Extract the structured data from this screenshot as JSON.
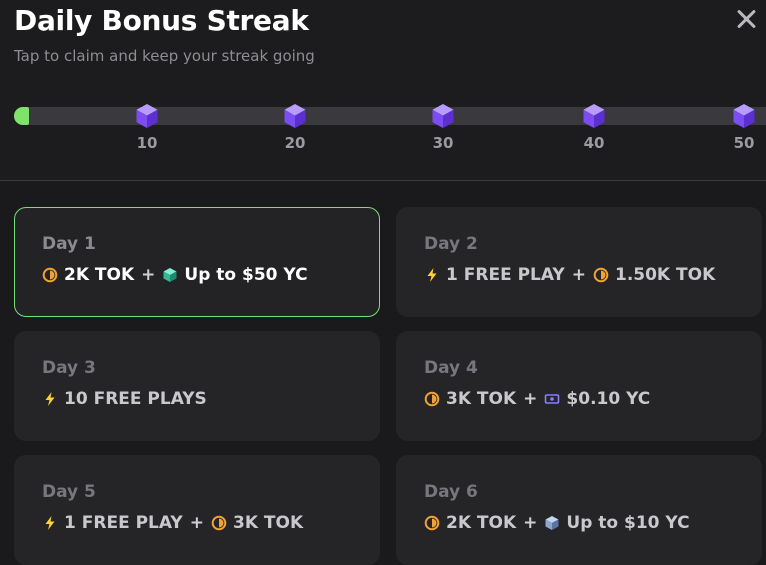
{
  "title": "Daily Bonus Streak",
  "subtitle": "Tap to claim and keep your streak going",
  "progress": {
    "current": 1,
    "max": 50,
    "fill_color": "#7fe36b"
  },
  "milestones": [
    {
      "label": "10",
      "icon": "purple-cube-icon"
    },
    {
      "label": "20",
      "icon": "purple-cube-icon"
    },
    {
      "label": "30",
      "icon": "purple-cube-icon"
    },
    {
      "label": "40",
      "icon": "purple-cube-icon"
    },
    {
      "label": "50",
      "icon": "purple-cube-icon"
    }
  ],
  "days": [
    {
      "label": "Day 1",
      "active": true,
      "rewards": [
        {
          "icon": "tok-coin-icon",
          "text": "2K TOK"
        },
        {
          "icon": "teal-cube-icon",
          "text": "Up to $50 YC"
        }
      ]
    },
    {
      "label": "Day 2",
      "rewards": [
        {
          "icon": "lightning-icon",
          "text": "1 FREE PLAY"
        },
        {
          "icon": "tok-coin-icon",
          "text": "1.50K TOK"
        }
      ]
    },
    {
      "label": "Day 3",
      "rewards": [
        {
          "icon": "lightning-icon",
          "text": "10 FREE PLAYS"
        }
      ]
    },
    {
      "label": "Day 4",
      "rewards": [
        {
          "icon": "tok-coin-icon",
          "text": "3K TOK"
        },
        {
          "icon": "cash-icon",
          "text": "$0.10 YC"
        }
      ]
    },
    {
      "label": "Day 5",
      "rewards": [
        {
          "icon": "lightning-icon",
          "text": "1 FREE PLAY"
        },
        {
          "icon": "tok-coin-icon",
          "text": "3K TOK"
        }
      ]
    },
    {
      "label": "Day 6",
      "rewards": [
        {
          "icon": "tok-coin-icon",
          "text": "2K TOK"
        },
        {
          "icon": "blue-cube-icon",
          "text": "Up to $10 YC"
        }
      ]
    }
  ],
  "colors": {
    "accent_green": "#74e07a",
    "coin_orange": "#f0a235",
    "bolt_yellow": "#ffd338",
    "cube_purple": "#8b5cf6"
  }
}
